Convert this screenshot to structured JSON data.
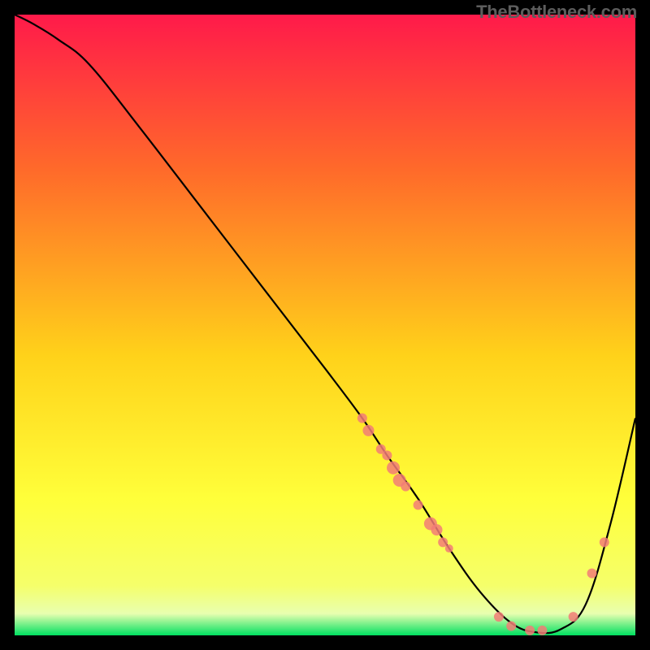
{
  "watermark": "TheBottleneck.com",
  "chart_data": {
    "type": "line",
    "title": "",
    "xlabel": "",
    "ylabel": "",
    "xlim": [
      0,
      100
    ],
    "ylim": [
      0,
      100
    ],
    "gradient_stops": [
      {
        "offset": 0,
        "color": "#ff1a4a"
      },
      {
        "offset": 0.25,
        "color": "#ff6a2a"
      },
      {
        "offset": 0.55,
        "color": "#ffd21a"
      },
      {
        "offset": 0.78,
        "color": "#ffff3a"
      },
      {
        "offset": 0.92,
        "color": "#f5ff6a"
      },
      {
        "offset": 0.965,
        "color": "#e8ffb0"
      },
      {
        "offset": 1.0,
        "color": "#00e060"
      }
    ],
    "series": [
      {
        "name": "bottleneck-curve",
        "x": [
          0,
          3,
          7,
          12,
          20,
          30,
          40,
          50,
          56,
          60,
          65,
          70,
          75,
          80,
          84,
          88,
          92,
          96,
          100
        ],
        "y": [
          100,
          98.5,
          96,
          92,
          82,
          69,
          56,
          43,
          35,
          29,
          22,
          14,
          7,
          2,
          0.5,
          1,
          5,
          18,
          35
        ],
        "color": "#000000"
      }
    ],
    "scatter": {
      "name": "highlight-points",
      "color": "#f27d77",
      "points": [
        {
          "x": 56,
          "y": 35,
          "r": 6
        },
        {
          "x": 57,
          "y": 33,
          "r": 7
        },
        {
          "x": 59,
          "y": 30,
          "r": 6
        },
        {
          "x": 60,
          "y": 29,
          "r": 6
        },
        {
          "x": 61,
          "y": 27,
          "r": 8
        },
        {
          "x": 62,
          "y": 25,
          "r": 8
        },
        {
          "x": 63,
          "y": 24,
          "r": 6
        },
        {
          "x": 65,
          "y": 21,
          "r": 6
        },
        {
          "x": 67,
          "y": 18,
          "r": 8
        },
        {
          "x": 68,
          "y": 17,
          "r": 7
        },
        {
          "x": 69,
          "y": 15,
          "r": 6
        },
        {
          "x": 70,
          "y": 14,
          "r": 5
        },
        {
          "x": 78,
          "y": 3,
          "r": 6
        },
        {
          "x": 80,
          "y": 1.5,
          "r": 6
        },
        {
          "x": 83,
          "y": 0.8,
          "r": 6
        },
        {
          "x": 85,
          "y": 0.8,
          "r": 6
        },
        {
          "x": 90,
          "y": 3,
          "r": 6
        },
        {
          "x": 93,
          "y": 10,
          "r": 6
        },
        {
          "x": 95,
          "y": 15,
          "r": 6
        }
      ]
    }
  }
}
